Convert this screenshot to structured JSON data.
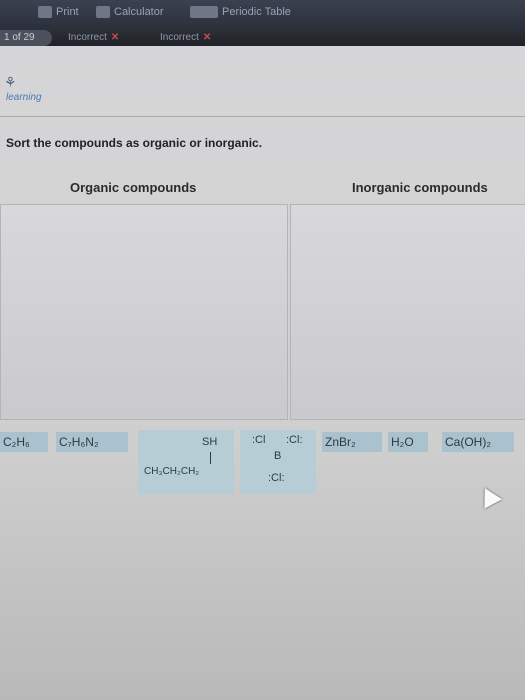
{
  "toolbar": {
    "print_label": "Print",
    "calculator_label": "Calculator",
    "periodic_table_label": "Periodic Table"
  },
  "status": {
    "question_counter": "1 of 29",
    "attempts": [
      "Incorrect",
      "Incorrect"
    ]
  },
  "brand": {
    "text": "learning"
  },
  "question": {
    "instruction": "Sort the compounds as organic or inorganic.",
    "organic_heading": "Organic compounds",
    "inorganic_heading": "Inorganic compounds"
  },
  "compounds": {
    "c2h6": "C₂H₆",
    "c7h6n2": "C₇H₆N₂",
    "thiol_sh": "SH",
    "thiol_chain": "CH₃CH₂CH₂",
    "bcl3_cl1": ":Cl",
    "bcl3_cl2": ":Cl:",
    "bcl3_b": "B",
    "bcl3_cl3": ":Cl:",
    "znbr2": "ZnBr₂",
    "h2o": "H₂O",
    "caoh2": "Ca(OH)₂"
  }
}
